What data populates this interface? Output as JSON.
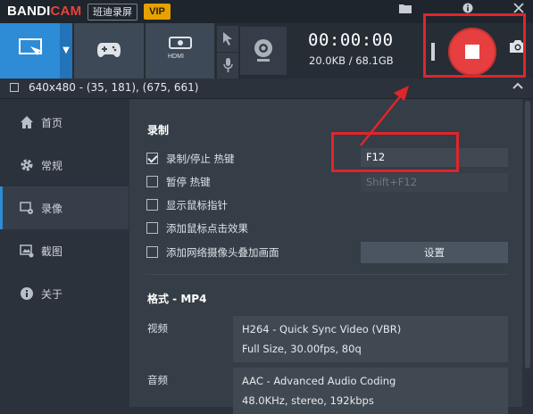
{
  "app": {
    "logo_part1": "BANDI",
    "logo_part2": "CAM",
    "name_cn": "班迪录屏",
    "vip_badge": "VIP"
  },
  "titlebar_icons": [
    "folder-icon",
    "info-icon",
    "minimize-icon",
    "close-icon"
  ],
  "toolbar": {
    "modes": [
      {
        "name": "screen-mode",
        "icon": "screen-rect-icon"
      },
      {
        "name": "game-mode",
        "icon": "gamepad-icon"
      },
      {
        "name": "hdmi-mode",
        "icon": "hdmi-icon",
        "label": "HDMI"
      }
    ],
    "timer": "00:00:00",
    "size": "20.0KB / 68.1GB"
  },
  "area": {
    "text": "640x480 - (35, 181), (675, 661)"
  },
  "sidebar": {
    "items": [
      {
        "label": "首页",
        "icon": "home-icon"
      },
      {
        "label": "常规",
        "icon": "gear-icon"
      },
      {
        "label": "录像",
        "icon": "video-settings-icon",
        "active": true
      },
      {
        "label": "截图",
        "icon": "image-icon"
      },
      {
        "label": "关于",
        "icon": "info-icon"
      }
    ]
  },
  "record": {
    "section_title": "录制",
    "options": [
      {
        "label": "录制/停止 热键",
        "checked": true
      },
      {
        "label": "暂停 热键",
        "checked": false
      },
      {
        "label": "显示鼠标指针",
        "checked": false
      },
      {
        "label": "添加鼠标点击效果",
        "checked": false
      },
      {
        "label": "添加网络摄像头叠加画面",
        "checked": false
      }
    ],
    "hotkey_record": "F12",
    "hotkey_pause": "Shift+F12",
    "settings_button": "设置"
  },
  "format": {
    "section_title": "格式 - MP4",
    "video_label": "视频",
    "video_line1": "H264 - Quick Sync Video (VBR)",
    "video_line2": "Full Size, 30.00fps, 80q",
    "audio_label": "音频",
    "audio_line1": "AAC - Advanced Audio Coding",
    "audio_line2": "48.0KHz, stereo, 192kbps"
  },
  "colors": {
    "accent": "#2e8bd6",
    "record": "#e73f3f",
    "highlight": "#e0252b",
    "vip": "#e6a100"
  }
}
